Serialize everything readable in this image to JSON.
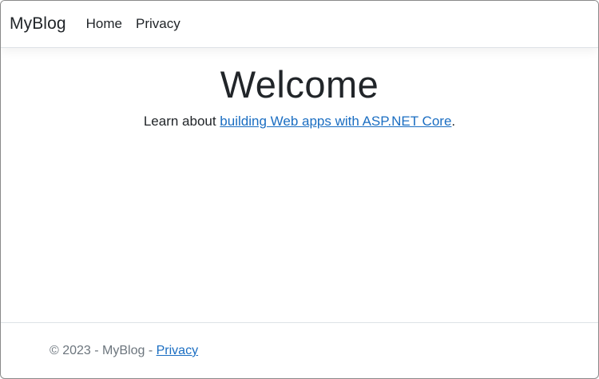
{
  "navbar": {
    "brand": "MyBlog",
    "links": [
      {
        "label": "Home"
      },
      {
        "label": "Privacy"
      }
    ]
  },
  "main": {
    "heading": "Welcome",
    "lead_prefix": "Learn about ",
    "lead_link": "building Web apps with ASP.NET Core",
    "lead_suffix": "."
  },
  "footer": {
    "text": "© 2023 - MyBlog - ",
    "privacy_link": "Privacy"
  },
  "colors": {
    "link": "#1b6ec2",
    "text": "#212529",
    "muted": "#6c757d",
    "border": "#dee2e6"
  }
}
